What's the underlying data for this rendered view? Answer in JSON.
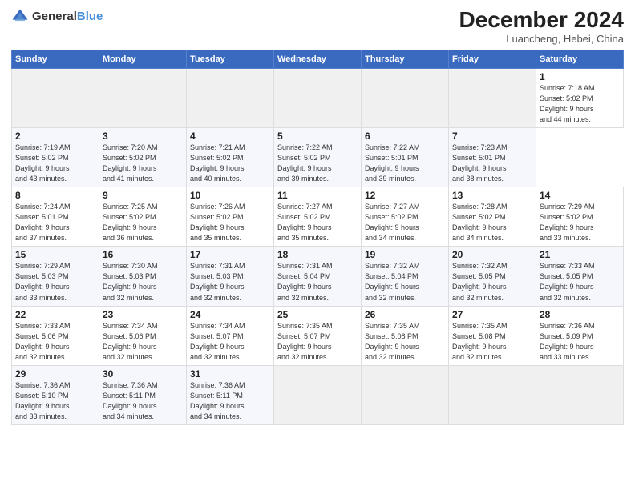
{
  "header": {
    "logo_general": "General",
    "logo_blue": "Blue",
    "month_title": "December 2024",
    "location": "Luancheng, Hebei, China"
  },
  "calendar": {
    "headers": [
      "Sunday",
      "Monday",
      "Tuesday",
      "Wednesday",
      "Thursday",
      "Friday",
      "Saturday"
    ],
    "weeks": [
      [
        {
          "day": "",
          "info": "",
          "empty": true
        },
        {
          "day": "",
          "info": "",
          "empty": true
        },
        {
          "day": "",
          "info": "",
          "empty": true
        },
        {
          "day": "",
          "info": "",
          "empty": true
        },
        {
          "day": "",
          "info": "",
          "empty": true
        },
        {
          "day": "",
          "info": "",
          "empty": true
        },
        {
          "day": "1",
          "info": "Sunrise: 7:18 AM\nSunset: 5:02 PM\nDaylight: 9 hours\nand 44 minutes."
        }
      ],
      [
        {
          "day": "2",
          "info": "Sunrise: 7:19 AM\nSunset: 5:02 PM\nDaylight: 9 hours\nand 43 minutes."
        },
        {
          "day": "3",
          "info": "Sunrise: 7:20 AM\nSunset: 5:02 PM\nDaylight: 9 hours\nand 41 minutes."
        },
        {
          "day": "4",
          "info": "Sunrise: 7:21 AM\nSunset: 5:02 PM\nDaylight: 9 hours\nand 40 minutes."
        },
        {
          "day": "5",
          "info": "Sunrise: 7:22 AM\nSunset: 5:02 PM\nDaylight: 9 hours\nand 39 minutes."
        },
        {
          "day": "6",
          "info": "Sunrise: 7:22 AM\nSunset: 5:01 PM\nDaylight: 9 hours\nand 39 minutes."
        },
        {
          "day": "7",
          "info": "Sunrise: 7:23 AM\nSunset: 5:01 PM\nDaylight: 9 hours\nand 38 minutes."
        }
      ],
      [
        {
          "day": "8",
          "info": "Sunrise: 7:24 AM\nSunset: 5:01 PM\nDaylight: 9 hours\nand 37 minutes."
        },
        {
          "day": "9",
          "info": "Sunrise: 7:25 AM\nSunset: 5:02 PM\nDaylight: 9 hours\nand 36 minutes."
        },
        {
          "day": "10",
          "info": "Sunrise: 7:26 AM\nSunset: 5:02 PM\nDaylight: 9 hours\nand 35 minutes."
        },
        {
          "day": "11",
          "info": "Sunrise: 7:27 AM\nSunset: 5:02 PM\nDaylight: 9 hours\nand 35 minutes."
        },
        {
          "day": "12",
          "info": "Sunrise: 7:27 AM\nSunset: 5:02 PM\nDaylight: 9 hours\nand 34 minutes."
        },
        {
          "day": "13",
          "info": "Sunrise: 7:28 AM\nSunset: 5:02 PM\nDaylight: 9 hours\nand 34 minutes."
        },
        {
          "day": "14",
          "info": "Sunrise: 7:29 AM\nSunset: 5:02 PM\nDaylight: 9 hours\nand 33 minutes."
        }
      ],
      [
        {
          "day": "15",
          "info": "Sunrise: 7:29 AM\nSunset: 5:03 PM\nDaylight: 9 hours\nand 33 minutes."
        },
        {
          "day": "16",
          "info": "Sunrise: 7:30 AM\nSunset: 5:03 PM\nDaylight: 9 hours\nand 32 minutes."
        },
        {
          "day": "17",
          "info": "Sunrise: 7:31 AM\nSunset: 5:03 PM\nDaylight: 9 hours\nand 32 minutes."
        },
        {
          "day": "18",
          "info": "Sunrise: 7:31 AM\nSunset: 5:04 PM\nDaylight: 9 hours\nand 32 minutes."
        },
        {
          "day": "19",
          "info": "Sunrise: 7:32 AM\nSunset: 5:04 PM\nDaylight: 9 hours\nand 32 minutes."
        },
        {
          "day": "20",
          "info": "Sunrise: 7:32 AM\nSunset: 5:05 PM\nDaylight: 9 hours\nand 32 minutes."
        },
        {
          "day": "21",
          "info": "Sunrise: 7:33 AM\nSunset: 5:05 PM\nDaylight: 9 hours\nand 32 minutes."
        }
      ],
      [
        {
          "day": "22",
          "info": "Sunrise: 7:33 AM\nSunset: 5:06 PM\nDaylight: 9 hours\nand 32 minutes."
        },
        {
          "day": "23",
          "info": "Sunrise: 7:34 AM\nSunset: 5:06 PM\nDaylight: 9 hours\nand 32 minutes."
        },
        {
          "day": "24",
          "info": "Sunrise: 7:34 AM\nSunset: 5:07 PM\nDaylight: 9 hours\nand 32 minutes."
        },
        {
          "day": "25",
          "info": "Sunrise: 7:35 AM\nSunset: 5:07 PM\nDaylight: 9 hours\nand 32 minutes."
        },
        {
          "day": "26",
          "info": "Sunrise: 7:35 AM\nSunset: 5:08 PM\nDaylight: 9 hours\nand 32 minutes."
        },
        {
          "day": "27",
          "info": "Sunrise: 7:35 AM\nSunset: 5:08 PM\nDaylight: 9 hours\nand 32 minutes."
        },
        {
          "day": "28",
          "info": "Sunrise: 7:36 AM\nSunset: 5:09 PM\nDaylight: 9 hours\nand 33 minutes."
        }
      ],
      [
        {
          "day": "29",
          "info": "Sunrise: 7:36 AM\nSunset: 5:10 PM\nDaylight: 9 hours\nand 33 minutes."
        },
        {
          "day": "30",
          "info": "Sunrise: 7:36 AM\nSunset: 5:11 PM\nDaylight: 9 hours\nand 34 minutes."
        },
        {
          "day": "31",
          "info": "Sunrise: 7:36 AM\nSunset: 5:11 PM\nDaylight: 9 hours\nand 34 minutes."
        },
        {
          "day": "",
          "info": "",
          "empty": true
        },
        {
          "day": "",
          "info": "",
          "empty": true
        },
        {
          "day": "",
          "info": "",
          "empty": true
        },
        {
          "day": "",
          "info": "",
          "empty": true
        }
      ]
    ]
  }
}
